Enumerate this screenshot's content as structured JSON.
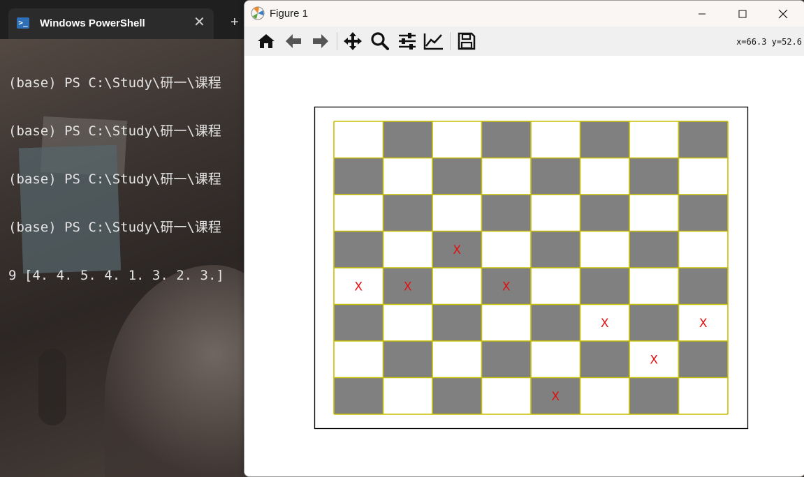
{
  "powershell": {
    "tab_title": "Windows PowerShell",
    "tab_icon": "powershell-icon",
    "console_lines": [
      "(base) PS C:\\Study\\研一\\课程",
      "(base) PS C:\\Study\\研一\\课程",
      "(base) PS C:\\Study\\研一\\课程",
      "(base) PS C:\\Study\\研一\\课程",
      "9 [4. 4. 5. 4. 1. 3. 2. 3.]"
    ]
  },
  "figure": {
    "window_title": "Figure 1",
    "coords": "x=66.3  y=52.6",
    "toolbar": [
      "home-icon",
      "back-arrow-icon",
      "forward-arrow-icon",
      "pan-icon",
      "zoom-icon",
      "configure-subplots-icon",
      "edit-axes-icon",
      "save-icon"
    ],
    "board": {
      "size": 8,
      "dark_color": "#808080",
      "light_color": "#ffffff",
      "grid_color": "#c8c000",
      "queen_mark": "X",
      "mark_color": "#e01010",
      "queen_rows": [
        4,
        4,
        5,
        4,
        1,
        3,
        2,
        3
      ]
    }
  }
}
